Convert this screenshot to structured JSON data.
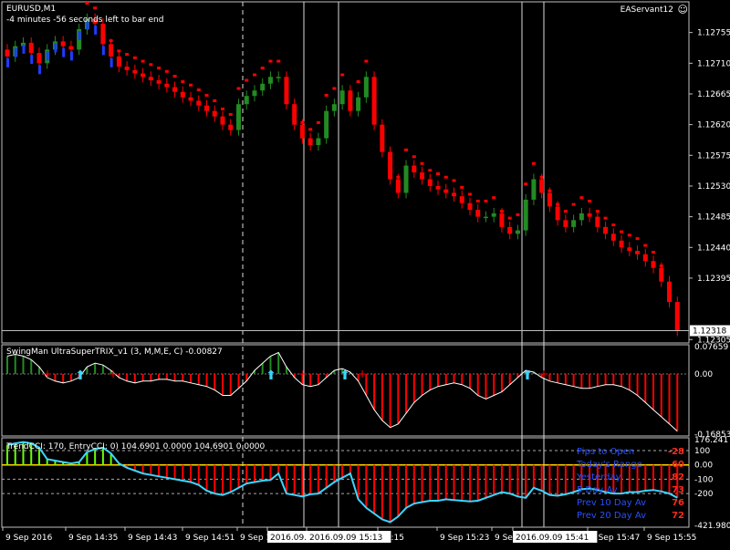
{
  "window": {
    "symbol_label": "EURUSD,M1",
    "bar_timer": "-4 minutes -56 seconds left to bar end",
    "account_label": "EAServant12"
  },
  "colors": {
    "bg": "#000000",
    "bull": "#228b22",
    "bear": "#ff0000",
    "blue": "#1e3cff",
    "grid": "#c0c0c0",
    "cyan": "#3cd6ff",
    "lime": "#66ff00",
    "yellow": "#ffd700",
    "infoBlue": "#2850ff",
    "infoRed": "#ff2a1a"
  },
  "main_chart": {
    "price_ticks": [
      "1.12755",
      "1.12710",
      "1.12665",
      "1.12620",
      "1.12575",
      "1.12530",
      "1.12485",
      "1.12440",
      "1.12395",
      "1.12305"
    ],
    "current_price": "1.12318",
    "price_range": [
      1.123,
      1.128
    ]
  },
  "trix_panel": {
    "title": "SwingMan UltraSuperTRIX_v1 (3, M,M,E, C) -0.00827",
    "ticks": [
      "0.07659",
      "0.00",
      "-0.16853"
    ]
  },
  "cci_panel": {
    "title": "TrendCCI: 170, EntryCCI: 0) 104.6901 0.0000 104.6901 0.0000",
    "ticks": [
      "176.241",
      "100",
      "0.00",
      "-100",
      "-200",
      "-421.9801"
    ]
  },
  "time_axis": {
    "labels": [
      "9 Sep 2016",
      "9 Sep 14:35",
      "9 Sep 14:43",
      "9 Sep 14:51",
      "9 Sep 1",
      "2016.09.",
      "2016.09.09 15:13",
      "15:15",
      "9 Sep 15:23",
      "9 Sep 15:31",
      "2016.09.09 15:41",
      "9 Sep 15:47",
      "9 Sep 15:55"
    ],
    "highlighted": [
      "2016.09.",
      "2016.09.09 15:13",
      "2016.09.09 15:41"
    ]
  },
  "info_box": {
    "rows": [
      {
        "label": "Pips to Open",
        "value": "-28"
      },
      {
        "label": "Today's Range",
        "value": "60"
      },
      {
        "label": "Yesterday",
        "value": "82"
      },
      {
        "label": "5 Day Av",
        "value": "73"
      },
      {
        "label": "Prev 10 Day Av",
        "value": "76"
      },
      {
        "label": "Prev 20 Day Av",
        "value": "72"
      }
    ]
  },
  "chart_data": [
    {
      "type": "candlestick",
      "title": "EURUSD,M1",
      "ylim": [
        1.123,
        1.128
      ],
      "close_series": [
        1.1272,
        1.12735,
        1.1274,
        1.12725,
        1.1271,
        1.1273,
        1.12742,
        1.12735,
        1.1273,
        1.1276,
        1.12775,
        1.12768,
        1.12738,
        1.1272,
        1.12705,
        1.127,
        1.12695,
        1.1269,
        1.12685,
        1.1268,
        1.12675,
        1.12668,
        1.1266,
        1.12655,
        1.12648,
        1.1264,
        1.12632,
        1.1262,
        1.12612,
        1.1265,
        1.12662,
        1.1267,
        1.1268,
        1.1269,
        1.1269,
        1.1265,
        1.1262,
        1.126,
        1.1259,
        1.126,
        1.1264,
        1.1265,
        1.1267,
        1.1264,
        1.1266,
        1.1269,
        1.1262,
        1.1258,
        1.1254,
        1.1252,
        1.1256,
        1.1255,
        1.1254,
        1.1253,
        1.12525,
        1.1252,
        1.12515,
        1.12505,
        1.12495,
        1.12485,
        1.12485,
        1.1249,
        1.1247,
        1.1246,
        1.12465,
        1.1251,
        1.1254,
        1.1252,
        1.125,
        1.1248,
        1.1247,
        1.1248,
        1.1249,
        1.12485,
        1.1247,
        1.1246,
        1.1245,
        1.1244,
        1.12435,
        1.1243,
        1.1242,
        1.1241,
        1.1239,
        1.1236,
        1.12318
      ]
    },
    {
      "type": "bar",
      "title": "SwingMan UltraSuperTRIX_v1 (3, M,M,E, C) -0.00827",
      "ylim": [
        -0.16853,
        0.07659
      ],
      "values": [
        0.05,
        0.055,
        0.05,
        0.04,
        0.02,
        -0.01,
        -0.02,
        -0.025,
        -0.02,
        -0.01,
        0.02,
        0.03,
        0.025,
        0.01,
        -0.01,
        -0.02,
        -0.025,
        -0.02,
        -0.02,
        -0.015,
        -0.015,
        -0.02,
        -0.02,
        -0.025,
        -0.03,
        -0.035,
        -0.045,
        -0.06,
        -0.06,
        -0.04,
        -0.02,
        0.01,
        0.03,
        0.05,
        0.06,
        0.02,
        -0.01,
        -0.03,
        -0.035,
        -0.03,
        -0.01,
        0.01,
        0.015,
        0.005,
        -0.02,
        -0.06,
        -0.1,
        -0.13,
        -0.15,
        -0.14,
        -0.11,
        -0.08,
        -0.06,
        -0.045,
        -0.035,
        -0.03,
        -0.025,
        -0.03,
        -0.04,
        -0.06,
        -0.07,
        -0.06,
        -0.05,
        -0.03,
        -0.01,
        0.01,
        0.005,
        -0.01,
        -0.02,
        -0.025,
        -0.03,
        -0.035,
        -0.04,
        -0.04,
        -0.035,
        -0.03,
        -0.03,
        -0.035,
        -0.045,
        -0.06,
        -0.08,
        -0.1,
        -0.12,
        -0.14,
        -0.16
      ]
    },
    {
      "type": "bar",
      "title": "TrendCCI: 170, EntryCCI: 0) 104.6901 0.0000 104.6901 0.0000",
      "ylim": [
        -421.9801,
        176.241
      ],
      "values": [
        140,
        150,
        160,
        150,
        120,
        40,
        30,
        20,
        10,
        20,
        90,
        110,
        120,
        80,
        10,
        -20,
        -40,
        -60,
        -70,
        -80,
        -90,
        -100,
        -110,
        -120,
        -140,
        -180,
        -200,
        -210,
        -190,
        -160,
        -130,
        -120,
        -110,
        -105,
        -60,
        -200,
        -210,
        -220,
        -205,
        -200,
        -160,
        -120,
        -90,
        -60,
        -240,
        -300,
        -340,
        -380,
        -400,
        -360,
        -300,
        -270,
        -260,
        -250,
        -250,
        -240,
        -245,
        -250,
        -255,
        -250,
        -230,
        -210,
        -190,
        -200,
        -220,
        -230,
        -160,
        -180,
        -210,
        -215,
        -205,
        -190,
        -170,
        -165,
        -175,
        -190,
        -200,
        -200,
        -190,
        -190,
        -180,
        -175,
        -185,
        -200,
        -230
      ]
    }
  ]
}
